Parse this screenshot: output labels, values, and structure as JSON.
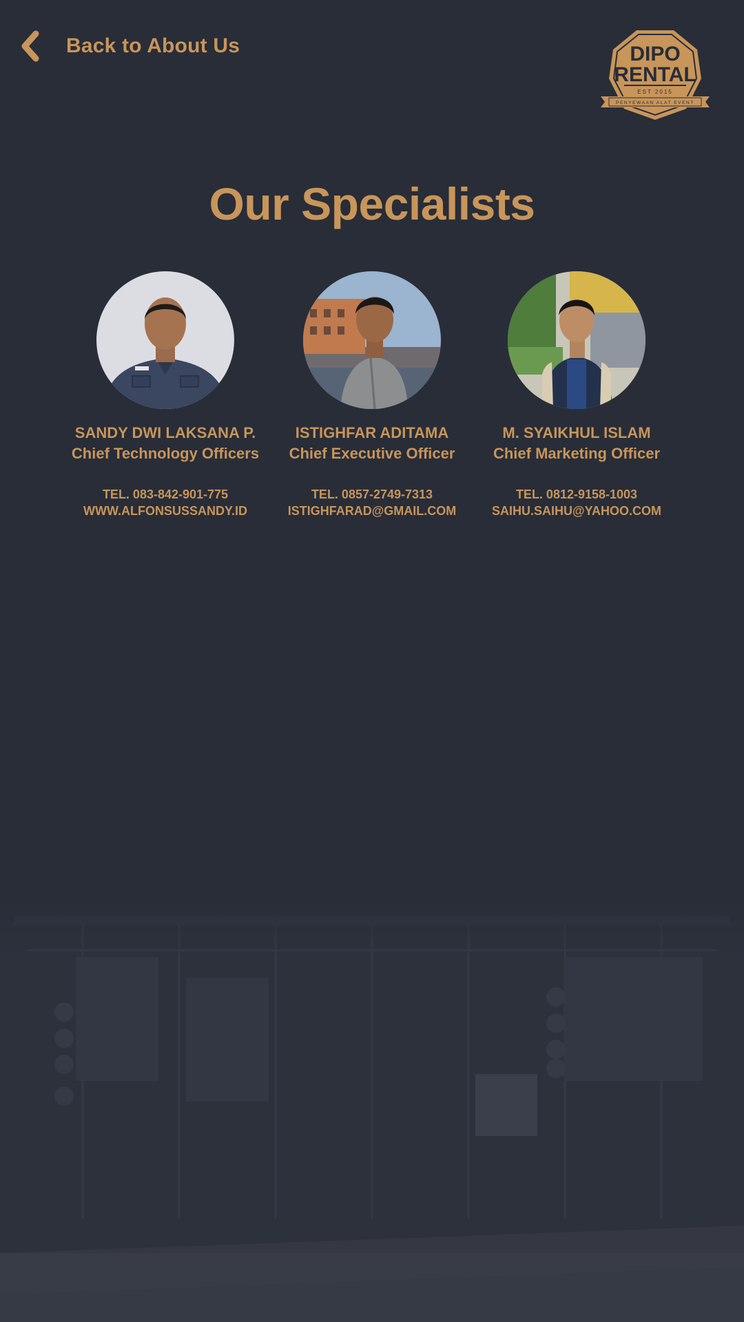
{
  "header": {
    "back_label": "Back to About Us",
    "logo": {
      "line1": "DIPO",
      "line2": "RENTAL",
      "est": "EST 2015",
      "ribbon": "PENYEWAAN ALAT EVENT"
    }
  },
  "page_title": "Our Specialists",
  "team": [
    {
      "name": "SANDY DWI LAKSANA P.",
      "role": "Chief Technology Officers",
      "tel": "TEL. 083-842-901-775",
      "contact": "WWW.ALFONSUSSANDY.ID"
    },
    {
      "name": "ISTIGHFAR ADITAMA",
      "role": "Chief Executive Officer",
      "tel": "TEL. 0857-2749-7313",
      "contact": "ISTIGHFARAD@GMAIL.COM"
    },
    {
      "name": "M. SYAIKHUL ISLAM",
      "role": "Chief Marketing Officer",
      "tel": "TEL. 0812-9158-1003",
      "contact": "SAIHU.SAIHU@YAHOO.COM"
    }
  ],
  "colors": {
    "background": "#282d38",
    "accent": "#c8955a"
  },
  "icons": {
    "back": "chevron-left-icon"
  }
}
